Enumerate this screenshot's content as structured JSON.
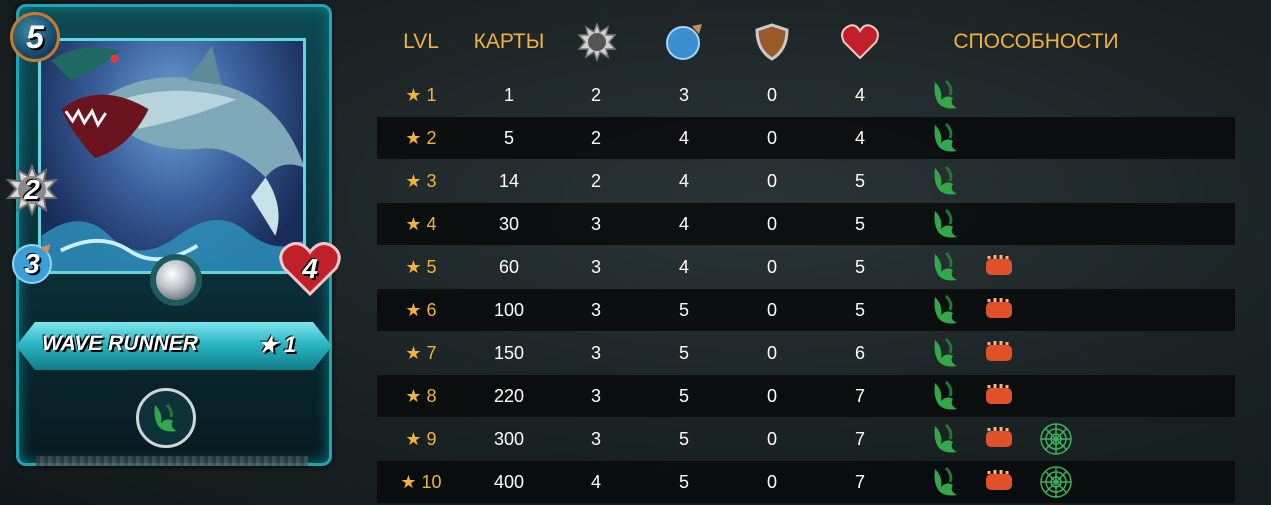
{
  "card": {
    "mana": "5",
    "attack": "2",
    "magic": "3",
    "health": "4",
    "name": "WAVE RUNNER",
    "level": "★ 1",
    "ability_icon": "claw-icon"
  },
  "table": {
    "headers": {
      "lvl": "LVL",
      "cards": "КАРТЫ",
      "attack_icon": "melee-attack-icon",
      "speed_icon": "speed-icon",
      "armor_icon": "shield-icon",
      "health_icon": "heart-icon",
      "abilities": "СПОСОБНОСТИ"
    },
    "rows": [
      {
        "lvl": "★ 1",
        "cards": "1",
        "attack": "2",
        "speed": "3",
        "armor": "0",
        "health": "4",
        "abilities": [
          "claw-icon"
        ]
      },
      {
        "lvl": "★ 2",
        "cards": "5",
        "attack": "2",
        "speed": "4",
        "armor": "0",
        "health": "4",
        "abilities": [
          "claw-icon"
        ]
      },
      {
        "lvl": "★ 3",
        "cards": "14",
        "attack": "2",
        "speed": "4",
        "armor": "0",
        "health": "5",
        "abilities": [
          "claw-icon"
        ]
      },
      {
        "lvl": "★ 4",
        "cards": "30",
        "attack": "3",
        "speed": "4",
        "armor": "0",
        "health": "5",
        "abilities": [
          "claw-icon"
        ]
      },
      {
        "lvl": "★ 5",
        "cards": "60",
        "attack": "3",
        "speed": "4",
        "armor": "0",
        "health": "5",
        "abilities": [
          "claw-icon",
          "fist-icon"
        ]
      },
      {
        "lvl": "★ 6",
        "cards": "100",
        "attack": "3",
        "speed": "5",
        "armor": "0",
        "health": "5",
        "abilities": [
          "claw-icon",
          "fist-icon"
        ]
      },
      {
        "lvl": "★ 7",
        "cards": "150",
        "attack": "3",
        "speed": "5",
        "armor": "0",
        "health": "6",
        "abilities": [
          "claw-icon",
          "fist-icon"
        ]
      },
      {
        "lvl": "★ 8",
        "cards": "220",
        "attack": "3",
        "speed": "5",
        "armor": "0",
        "health": "7",
        "abilities": [
          "claw-icon",
          "fist-icon"
        ]
      },
      {
        "lvl": "★ 9",
        "cards": "300",
        "attack": "3",
        "speed": "5",
        "armor": "0",
        "health": "7",
        "abilities": [
          "claw-icon",
          "fist-icon",
          "web-icon"
        ]
      },
      {
        "lvl": "★ 10",
        "cards": "400",
        "attack": "4",
        "speed": "5",
        "armor": "0",
        "health": "7",
        "abilities": [
          "claw-icon",
          "fist-icon",
          "web-icon"
        ]
      }
    ]
  },
  "colors": {
    "header_text": "#f3b23a",
    "row_text": "#ffffff",
    "dark_row": "#080a0c"
  }
}
